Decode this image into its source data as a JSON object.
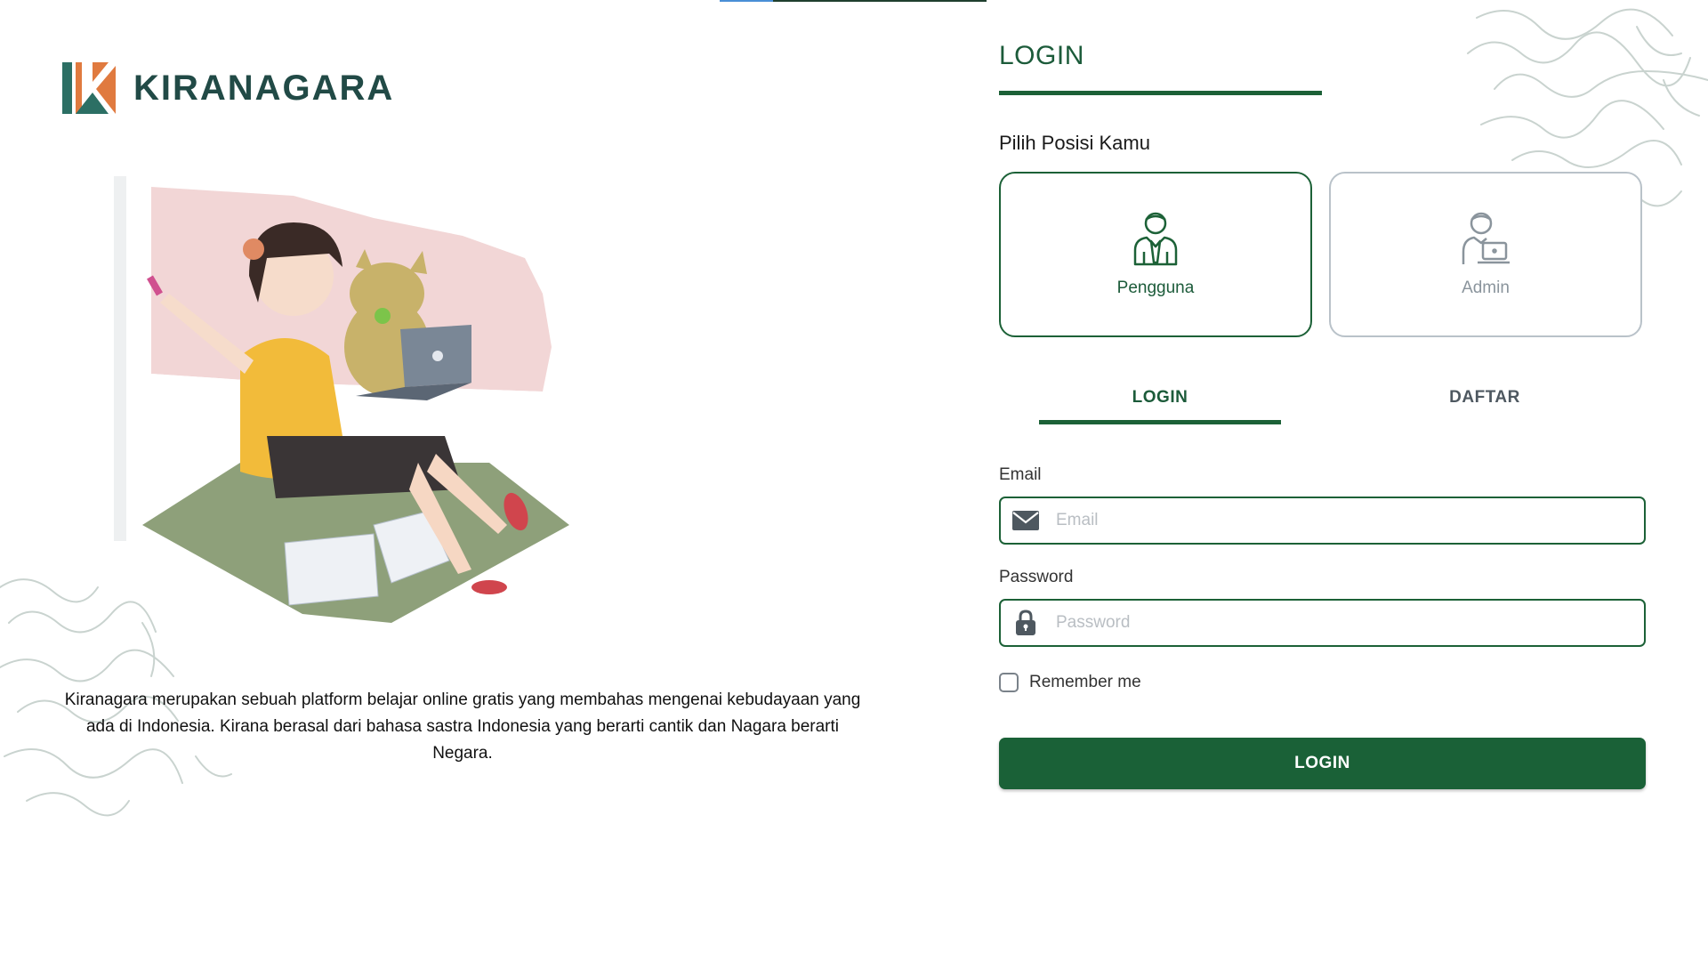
{
  "brand": {
    "name": "KIRANAGARA"
  },
  "left": {
    "description": "Kiranagara merupakan sebuah platform belajar online gratis yang membahas mengenai kebudayaan yang ada di Indonesia. Kirana berasal dari bahasa sastra Indonesia yang berarti cantik dan Nagara berarti Negara."
  },
  "form": {
    "title": "LOGIN",
    "choose_label": "Pilih Posisi Kamu",
    "roles": [
      {
        "label": "Pengguna",
        "icon": "user-icon",
        "selected": true
      },
      {
        "label": "Admin",
        "icon": "admin-icon",
        "selected": false
      }
    ],
    "tabs": [
      {
        "label": "LOGIN",
        "active": true
      },
      {
        "label": "DAFTAR",
        "active": false
      }
    ],
    "email": {
      "label": "Email",
      "placeholder": "Email",
      "value": "",
      "icon": "envelope-icon"
    },
    "password": {
      "label": "Password",
      "placeholder": "Password",
      "value": "",
      "icon": "lock-icon"
    },
    "remember": {
      "label": "Remember me",
      "checked": false
    },
    "submit_label": "LOGIN"
  },
  "colors": {
    "primary": "#1c6137",
    "brand_orange": "#e07a3f",
    "brand_teal": "#2c6f64",
    "flag_red": "#f2d6d6"
  }
}
